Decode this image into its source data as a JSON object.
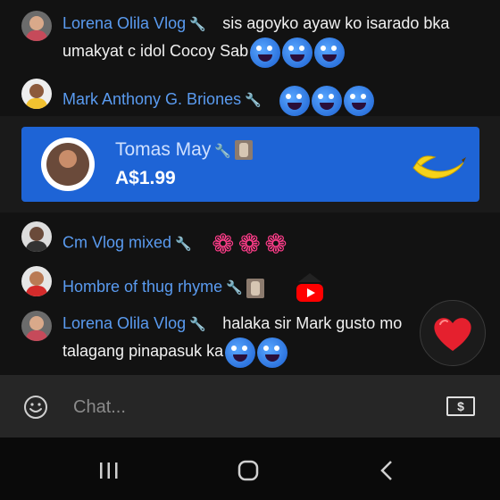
{
  "messages": [
    {
      "author": "Lorena Olila Vlog",
      "line1": "sis agoyko ayaw ko isarado bka",
      "line2": "umakyat c idol Cocoy Sab"
    },
    {
      "author": "Mark Anthony G. Briones"
    },
    {
      "author": "Cm Vlog mixed"
    },
    {
      "author": "Hombre of thug rhyme"
    },
    {
      "author": "Lorena Olila Vlog",
      "line1": "halaka sir Mark gusto mo",
      "line2": "talagang pinapasuk ka"
    }
  ],
  "superchat": {
    "name": "Tomas May",
    "amount": "A$1.99",
    "color": "#1e64d6"
  },
  "input": {
    "placeholder": "Chat..."
  },
  "icons": {
    "wrench": "wrench-icon",
    "smiley": "smiley-icon",
    "dollar": "dollar-icon",
    "heart": "heart-icon",
    "banana": "banana-sticker",
    "nav_recent": "recent-apps-icon",
    "nav_home": "home-icon",
    "nav_back": "back-icon"
  },
  "colors": {
    "author": "#5a9bf0",
    "superchat_bg": "#1e64d6",
    "heart": "#e5202e"
  },
  "dollar_label": "$"
}
